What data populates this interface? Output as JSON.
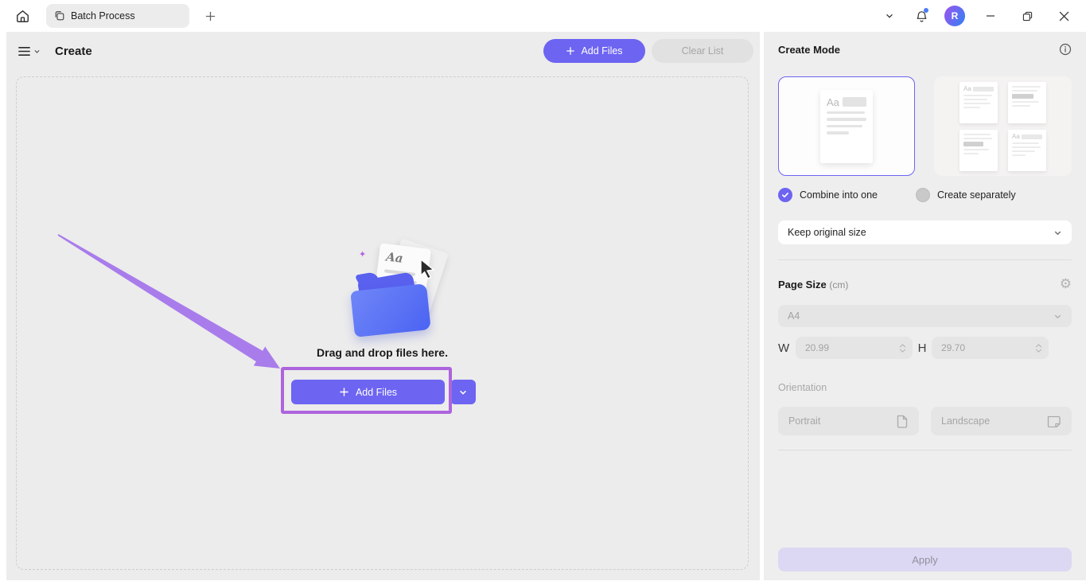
{
  "titlebar": {
    "tab_label": "Batch Process",
    "avatar_initial": "R"
  },
  "header": {
    "title": "Create",
    "add_files_label": "Add Files",
    "clear_list_label": "Clear List"
  },
  "dropzone": {
    "hint": "Drag and drop files here.",
    "add_files_label": "Add Files",
    "doc_sample": "Aa",
    "sparkle": "✦"
  },
  "panel": {
    "title": "Create Mode",
    "combine_label": "Combine into one",
    "separate_label": "Create separately",
    "size_mode_value": "Keep original size",
    "page_size_label": "Page Size",
    "page_size_unit": "(cm)",
    "preset_value": "A4",
    "width_label": "W",
    "width_value": "20.99",
    "height_label": "H",
    "height_value": "29.70",
    "orientation_label": "Orientation",
    "portrait_label": "Portrait",
    "landscape_label": "Landscape",
    "apply_label": "Apply",
    "doc_sample": "Aa"
  },
  "colors": {
    "accent": "#6d64f2",
    "annotation": "#ad64dd",
    "arrow": "#a97ceb",
    "pane_bg": "#ececec"
  }
}
